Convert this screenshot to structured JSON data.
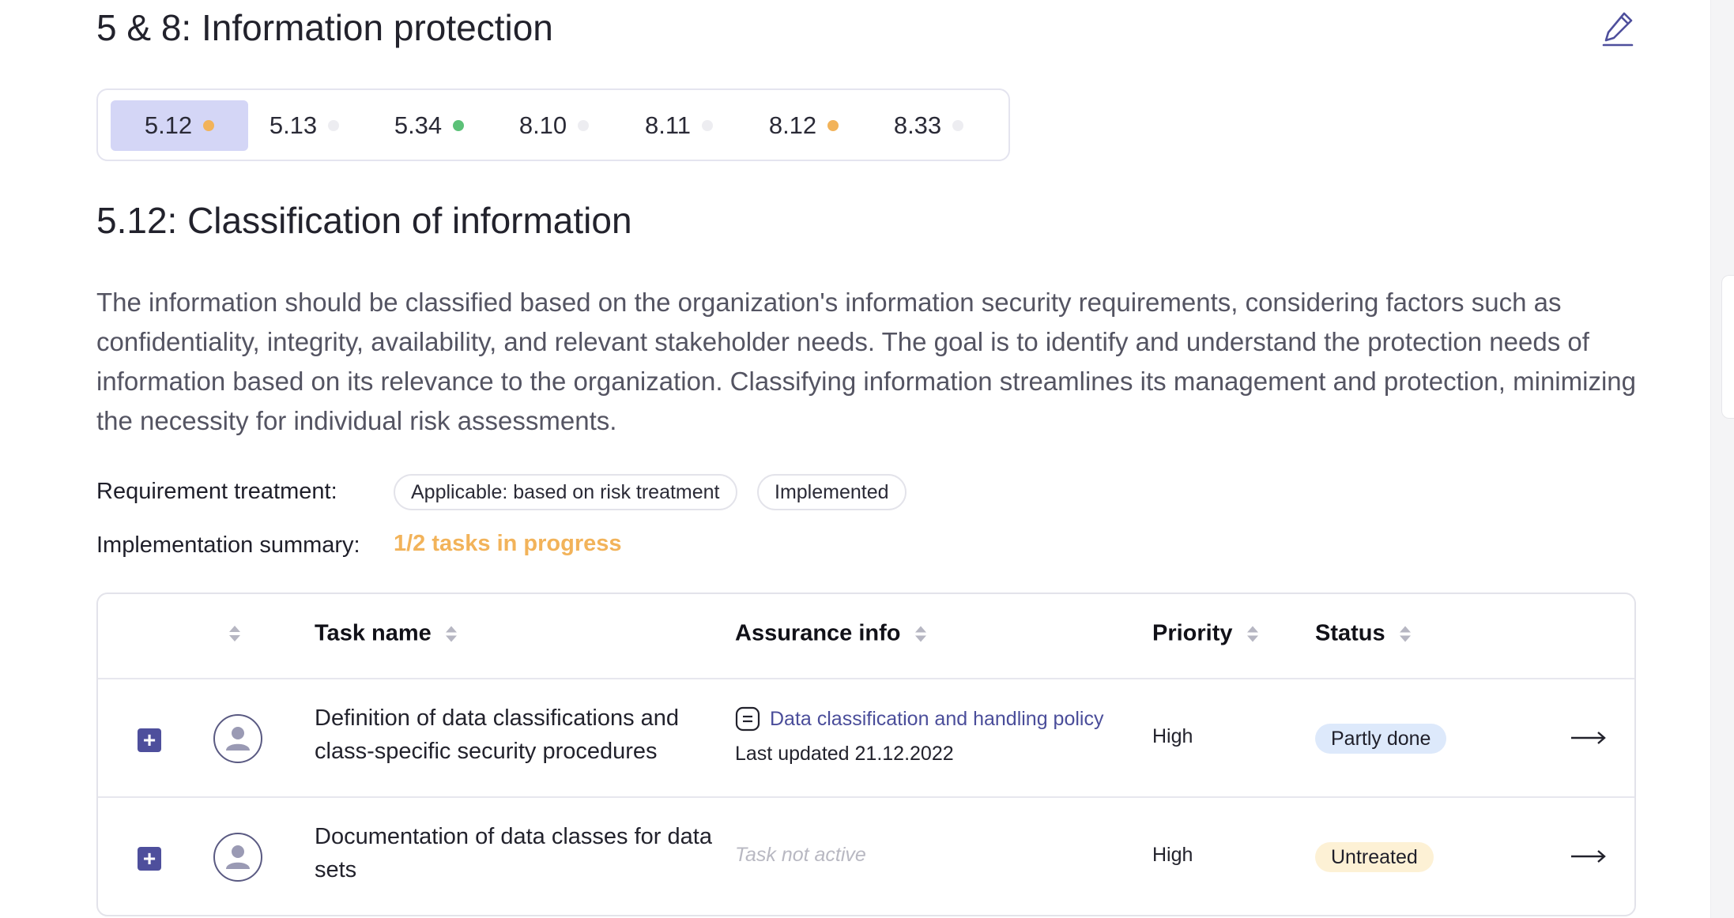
{
  "section": {
    "title": "5 & 8: Information protection"
  },
  "tabs": [
    {
      "label": "5.12",
      "status": "in-progress",
      "dot_color": "#f2b35a",
      "active": true
    },
    {
      "label": "5.13",
      "status": "none",
      "dot_color": "#ededf1",
      "active": false
    },
    {
      "label": "5.34",
      "status": "done",
      "dot_color": "#5cc178",
      "active": false
    },
    {
      "label": "8.10",
      "status": "none",
      "dot_color": "#ededf1",
      "active": false
    },
    {
      "label": "8.11",
      "status": "none",
      "dot_color": "#ededf1",
      "active": false
    },
    {
      "label": "8.12",
      "status": "in-progress",
      "dot_color": "#f2b35a",
      "active": false
    },
    {
      "label": "8.33",
      "status": "none",
      "dot_color": "#ededf1",
      "active": false
    }
  ],
  "requirement": {
    "title": "5.12: Classification of information",
    "description": "The information should be classified based on the organization's information security requirements, considering factors such as confidentiality, integrity, availability, and relevant stakeholder needs. The goal is to identify and understand the protection needs of information based on its relevance to the organization. Classifying information streamlines its management and protection, minimizing the necessity for individual risk assessments.",
    "treatment_label": "Requirement treatment:",
    "treatment_chips": [
      "Applicable: based on risk treatment",
      "Implemented"
    ],
    "summary_label": "Implementation summary:",
    "summary_value": "1/2 tasks in progress"
  },
  "table": {
    "headers": {
      "task_name": "Task name",
      "assurance": "Assurance info",
      "priority": "Priority",
      "status": "Status"
    },
    "rows": [
      {
        "task": "Definition of data classifications and class-specific security procedures",
        "assurance_link": "Data classification and handling policy",
        "assurance_updated": "Last updated 21.12.2022",
        "priority": "High",
        "status": "Partly done",
        "status_color": "#dde9fb"
      },
      {
        "task": "Documentation of data classes for data sets",
        "assurance_inactive": "Task not active",
        "priority": "High",
        "status": "Untreated",
        "status_color": "#fdf1d5"
      }
    ]
  },
  "icons": {
    "edit": "pencil-icon",
    "document": "document-icon",
    "avatar": "user-avatar-icon",
    "expand": "plus-icon",
    "open": "arrow-right-icon"
  },
  "colors": {
    "accent": "#4e4f9c",
    "active_tab": "#d4d6f6",
    "in_progress": "#f2b35a",
    "done": "#5cc178"
  }
}
